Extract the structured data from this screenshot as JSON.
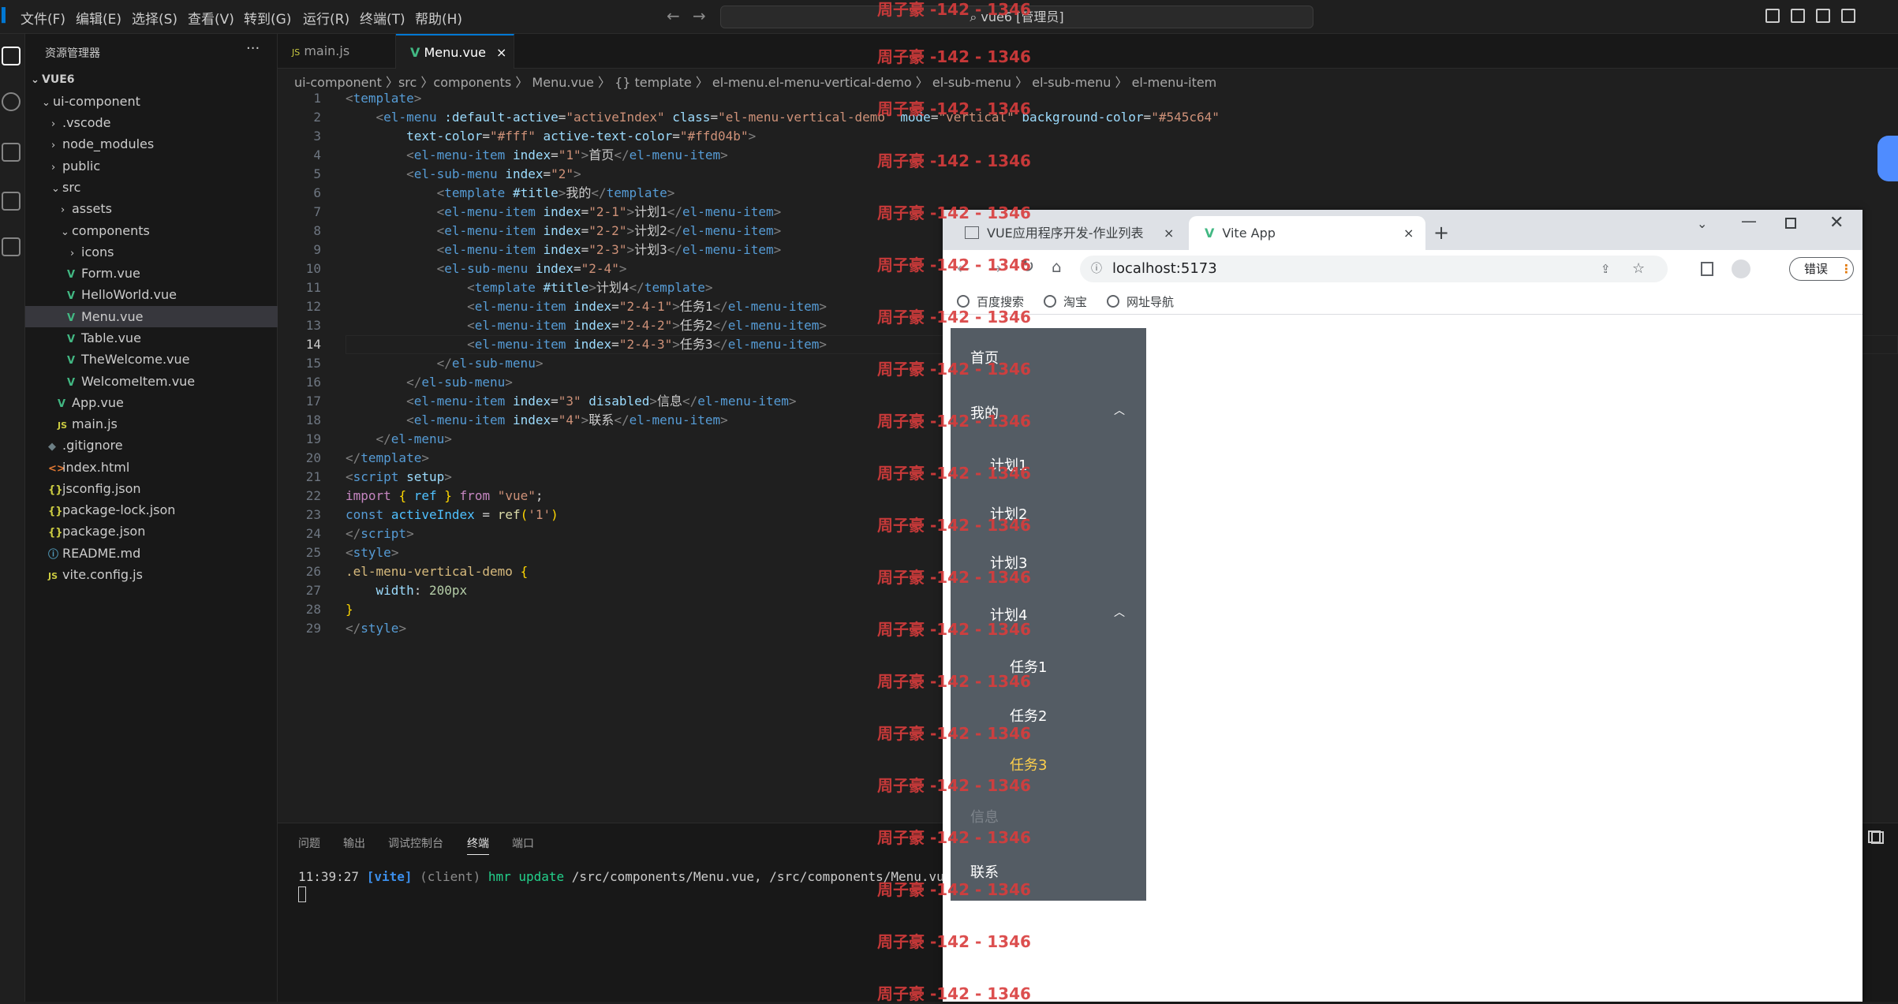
{
  "titlebar": {
    "menus": [
      "文件(F)",
      "编辑(E)",
      "选择(S)",
      "查看(V)",
      "转到(G)",
      "运行(R)",
      "终端(T)",
      "帮助(H)"
    ],
    "command_center": "vue6 [管理员]"
  },
  "explorer": {
    "title": "资源管理器",
    "more": "···",
    "tree": [
      {
        "label": "VUE6",
        "kind": "root"
      },
      {
        "label": "ui-component",
        "kind": "folder-open"
      },
      {
        "label": ".vscode",
        "kind": "folder"
      },
      {
        "label": "node_modules",
        "kind": "folder"
      },
      {
        "label": "public",
        "kind": "folder"
      },
      {
        "label": "src",
        "kind": "folder-open"
      },
      {
        "label": "assets",
        "kind": "folder"
      },
      {
        "label": "components",
        "kind": "folder-open"
      },
      {
        "label": "icons",
        "kind": "folder"
      },
      {
        "label": "Form.vue",
        "kind": "vue"
      },
      {
        "label": "HelloWorld.vue",
        "kind": "vue"
      },
      {
        "label": "Menu.vue",
        "kind": "vue",
        "selected": true
      },
      {
        "label": "Table.vue",
        "kind": "vue"
      },
      {
        "label": "TheWelcome.vue",
        "kind": "vue"
      },
      {
        "label": "WelcomeItem.vue",
        "kind": "vue"
      },
      {
        "label": "App.vue",
        "kind": "vue"
      },
      {
        "label": "main.js",
        "kind": "js"
      },
      {
        "label": ".gitignore",
        "kind": "git"
      },
      {
        "label": "index.html",
        "kind": "html"
      },
      {
        "label": "jsconfig.json",
        "kind": "json"
      },
      {
        "label": "package-lock.json",
        "kind": "json"
      },
      {
        "label": "package.json",
        "kind": "json"
      },
      {
        "label": "README.md",
        "kind": "info"
      },
      {
        "label": "vite.config.js",
        "kind": "js"
      }
    ]
  },
  "editor": {
    "tabs": [
      {
        "label": "main.js",
        "icon": "JS"
      },
      {
        "label": "Menu.vue",
        "icon": "V",
        "close": "×"
      }
    ],
    "breadcrumb": "ui-component 〉src 〉components 〉 Menu.vue 〉 {} template 〉 el-menu.el-menu-vertical-demo 〉 el-sub-menu 〉 el-sub-menu 〉 el-menu-item",
    "current_line": 14,
    "line_count": 29
  },
  "panel": {
    "tabs": [
      "问题",
      "输出",
      "调试控制台",
      "终端",
      "端口"
    ],
    "active_tab": "终端",
    "term_time": "11:39:27 ",
    "term_vite": "[vite]",
    "term_client": " (client) ",
    "term_hmr": "hmr update ",
    "term_path": "/src/components/Menu.vue, /src/components/Menu.vue?vue&"
  },
  "browser": {
    "tabs": [
      {
        "label": "VUE应用程序开发-作业列表",
        "close": "×"
      },
      {
        "label": "Vite App",
        "close": "×"
      }
    ],
    "new_tab": "+",
    "url": "localhost:5173",
    "error_button": "错误",
    "bookmarks": [
      "百度搜索",
      "淘宝",
      "网址导航"
    ],
    "menu": {
      "background": "#545c64",
      "text_color": "#fff",
      "active_text_color": "#ffd04b",
      "items": [
        {
          "label": "首页",
          "level": 0
        },
        {
          "label": "我的",
          "level": 0,
          "submenu": true
        },
        {
          "label": "计划1",
          "level": 1
        },
        {
          "label": "计划2",
          "level": 1
        },
        {
          "label": "计划3",
          "level": 1
        },
        {
          "label": "计划4",
          "level": 1,
          "submenu": true
        },
        {
          "label": "任务1",
          "level": 2
        },
        {
          "label": "任务2",
          "level": 2
        },
        {
          "label": "任务3",
          "level": 2,
          "active": true
        },
        {
          "label": "信息",
          "level": 0,
          "disabled": true
        },
        {
          "label": "联系",
          "level": 0
        }
      ]
    }
  },
  "watermark": "周子豪 -142 - 1346",
  "colors": {
    "accent": "#0078d4",
    "vue_green": "#42b883",
    "watermark": "#d93c3c"
  }
}
